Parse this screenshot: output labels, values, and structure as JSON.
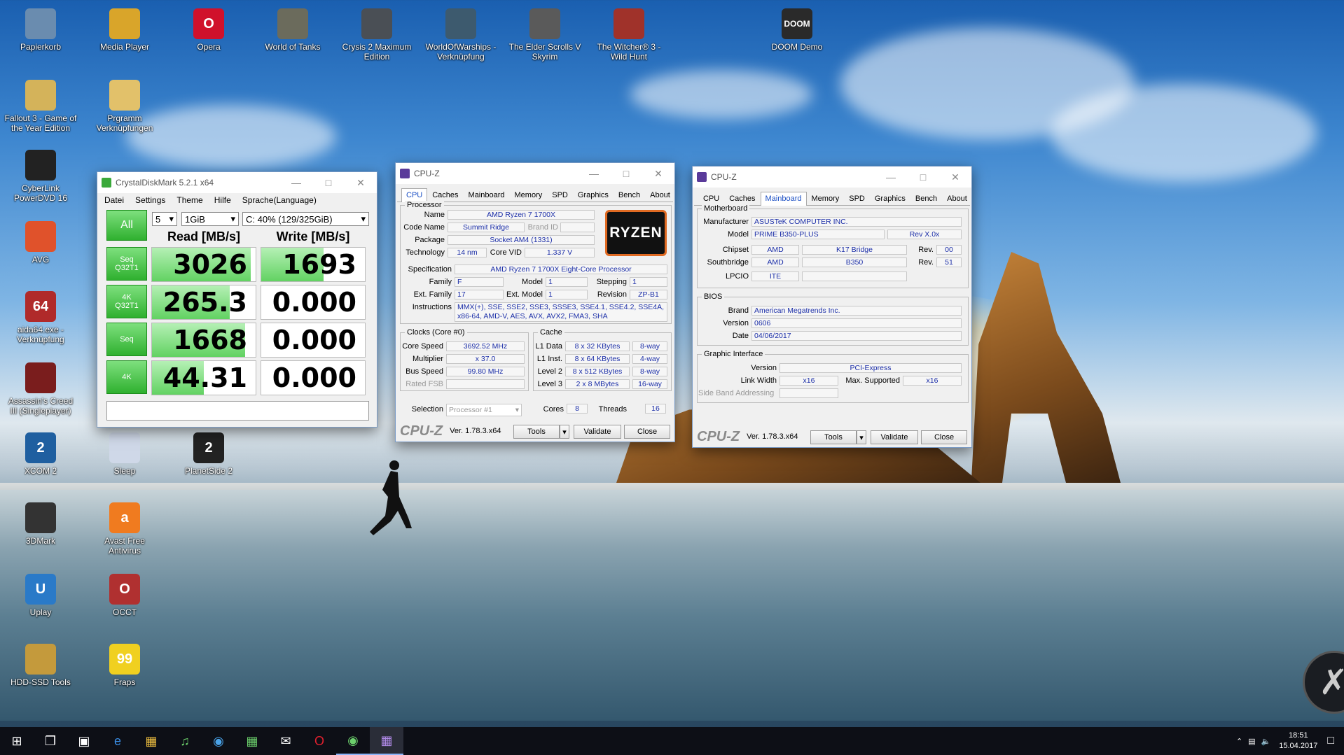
{
  "desktop": {
    "icons": [
      {
        "label": "Papierkorb",
        "color": "#6a8caf"
      },
      {
        "label": "Media Player",
        "color": "#d9a52a"
      },
      {
        "label": "Opera",
        "color": "#d0112b"
      },
      {
        "label": "World of Tanks",
        "color": "#6b6b5c"
      },
      {
        "label": "Crysis 2 Maximum Edition",
        "color": "#4a4f55"
      },
      {
        "label": "WorldOfWarships - Verknüpfung",
        "color": "#3d5a6e"
      },
      {
        "label": "The Elder Scrolls V Skyrim",
        "color": "#5a5a5a"
      },
      {
        "label": "The Witcher® 3 - Wild Hunt",
        "color": "#a0322a"
      },
      {
        "label": "DOOM Demo",
        "color": "#2a2a2a"
      },
      {
        "label": "Fallout 3 - Game of the Year Edition",
        "color": "#d4b35a"
      },
      {
        "label": "Prgramm Verknüpfungen",
        "color": "#e2c16a"
      },
      {
        "label": "CyberLink PowerDVD 16",
        "color": "#222"
      },
      {
        "label": "AVG",
        "color": "#e0522b"
      },
      {
        "label": "aida64.exe - Verknüpfung",
        "color": "#b02a2a"
      },
      {
        "label": "Assassin's Creed III (Singleplayer)",
        "color": "#7a1d1d"
      },
      {
        "label": "XCOM 2",
        "color": "#1f5fa0"
      },
      {
        "label": "Sleep",
        "color": "#cfd8e8"
      },
      {
        "label": "PlanetSide 2",
        "color": "#222"
      },
      {
        "label": "3DMark",
        "color": "#333"
      },
      {
        "label": "Avast Free Antivirus",
        "color": "#f07b1f"
      },
      {
        "label": "Uplay",
        "color": "#2a7ac8"
      },
      {
        "label": "OCCT",
        "color": "#b03030"
      },
      {
        "label": "HDD-SSD Tools",
        "color": "#c49a3c"
      },
      {
        "label": "Fraps",
        "color": "#f0d020"
      }
    ],
    "icon_glyphs": {
      "Opera": "O",
      "DOOM Demo": "DOOM",
      "OCCT": "O",
      "Uplay": "U",
      "Avast Free Antivirus": "a",
      "XCOM 2": "2",
      "PlanetSide 2": "2",
      "aida64.exe - Verknüpfung": "64",
      "Fraps": "99"
    }
  },
  "crystaldiskmark": {
    "title": "CrystalDiskMark 5.2.1 x64",
    "menu": [
      "Datei",
      "Settings",
      "Theme",
      "Hilfe",
      "Sprache(Language)"
    ],
    "all_label": "All",
    "count": "5",
    "size": "1GiB",
    "drive": "C: 40% (129/325GiB)",
    "read_header": "Read [MB/s]",
    "write_header": "Write [MB/s]",
    "rows": [
      {
        "label": "Seq\nQ32T1",
        "read": "3026",
        "write": "1693",
        "read_frac": 0.95,
        "write_frac": 0.6
      },
      {
        "label": "4K\nQ32T1",
        "read": "265.3",
        "write": "0.000",
        "read_frac": 0.75,
        "write_frac": 0
      },
      {
        "label": "Seq",
        "read": "1668",
        "write": "0.000",
        "read_frac": 0.9,
        "write_frac": 0
      },
      {
        "label": "4K",
        "read": "44.31",
        "write": "0.000",
        "read_frac": 0.5,
        "write_frac": 0
      }
    ],
    "comment": ""
  },
  "cpuz1": {
    "title": "CPU-Z",
    "tabs": [
      "CPU",
      "Caches",
      "Mainboard",
      "Memory",
      "SPD",
      "Graphics",
      "Bench",
      "About"
    ],
    "active_tab": "CPU",
    "processor_label": "Processor",
    "name_label": "Name",
    "name": "AMD Ryzen 7 1700X",
    "codename_label": "Code Name",
    "codename": "Summit Ridge",
    "brandid_label": "Brand ID",
    "package_label": "Package",
    "package": "Socket AM4 (1331)",
    "technology_label": "Technology",
    "technology": "14 nm",
    "corevid_label": "Core VID",
    "corevid": "1.337 V",
    "spec_label": "Specification",
    "spec": "AMD Ryzen 7 1700X Eight-Core Processor",
    "family_label": "Family",
    "family": "F",
    "model_label": "Model",
    "model": "1",
    "stepping_label": "Stepping",
    "stepping": "1",
    "extfamily_label": "Ext. Family",
    "extfamily": "17",
    "extmodel_label": "Ext. Model",
    "extmodel": "1",
    "revision_label": "Revision",
    "revision": "ZP-B1",
    "instructions_label": "Instructions",
    "instructions": "MMX(+), SSE, SSE2, SSE3, SSSE3, SSE4.1, SSE4.2, SSE4A, x86-64, AMD-V, AES, AVX, AVX2, FMA3, SHA",
    "clocks_label": "Clocks (Core #0)",
    "corespeed_label": "Core Speed",
    "corespeed": "3692.52 MHz",
    "multiplier_label": "Multiplier",
    "multiplier": "x 37.0",
    "busspeed_label": "Bus Speed",
    "busspeed": "99.80 MHz",
    "ratedfsb_label": "Rated FSB",
    "cache_label": "Cache",
    "l1d_label": "L1 Data",
    "l1d": "8 x 32 KBytes",
    "l1d_way": "8-way",
    "l1i_label": "L1 Inst.",
    "l1i": "8 x 64 KBytes",
    "l1i_way": "4-way",
    "l2_label": "Level 2",
    "l2": "8 x 512 KBytes",
    "l2_way": "8-way",
    "l3_label": "Level 3",
    "l3": "2 x 8 MBytes",
    "l3_way": "16-way",
    "selection_label": "Selection",
    "selection": "Processor #1",
    "cores_label": "Cores",
    "cores": "8",
    "threads_label": "Threads",
    "threads": "16",
    "logo_text": "RYZEN",
    "footer_logo": "CPU-Z",
    "version": "Ver. 1.78.3.x64",
    "tools": "Tools",
    "validate": "Validate",
    "close": "Close"
  },
  "cpuz2": {
    "title": "CPU-Z",
    "tabs": [
      "CPU",
      "Caches",
      "Mainboard",
      "Memory",
      "SPD",
      "Graphics",
      "Bench",
      "About"
    ],
    "active_tab": "Mainboard",
    "motherboard_label": "Motherboard",
    "manufacturer_label": "Manufacturer",
    "manufacturer": "ASUSTeK COMPUTER INC.",
    "model_label": "Model",
    "model": "PRIME B350-PLUS",
    "model_rev": "Rev X.0x",
    "chipset_label": "Chipset",
    "chipset_vendor": "AMD",
    "chipset": "K17 Bridge",
    "rev_label": "Rev.",
    "chipset_rev": "00",
    "southbridge_label": "Southbridge",
    "sb_vendor": "AMD",
    "sb": "B350",
    "sb_rev": "51",
    "lpcio_label": "LPCIO",
    "lpcio": "ITE",
    "bios_label": "BIOS",
    "brand_label": "Brand",
    "brand": "American Megatrends Inc.",
    "version_label": "Version",
    "version_val": "0606",
    "date_label": "Date",
    "date": "04/06/2017",
    "gi_label": "Graphic Interface",
    "giversion_label": "Version",
    "giversion": "PCI-Express",
    "linkwidth_label": "Link Width",
    "linkwidth": "x16",
    "maxsup_label": "Max. Supported",
    "maxsup": "x16",
    "sideband_label": "Side Band Addressing",
    "footer_logo": "CPU-Z",
    "version": "Ver. 1.78.3.x64",
    "tools": "Tools",
    "validate": "Validate",
    "close": "Close"
  },
  "taskbar": {
    "time": "18:51",
    "date": "15.04.2017"
  }
}
